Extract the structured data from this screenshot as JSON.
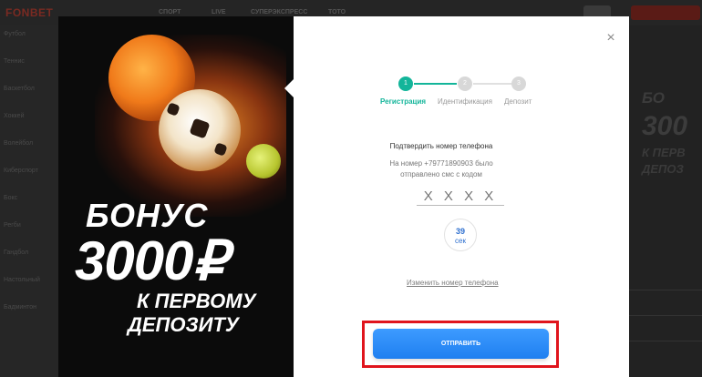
{
  "background": {
    "logo": "FONBET",
    "menu": [
      "СПОРТ",
      "LIVE",
      "СУПЕРЭКСПРЕСС",
      "ТОТО"
    ],
    "sidebar_items": [
      "Футбол",
      "Теннис",
      "Баскетбол",
      "Хоккей",
      "Волейбол",
      "Киберспорт",
      "Бокс",
      "Регби",
      "Гандбол",
      "Настольный",
      "Бадминтон"
    ],
    "right_promo_line1": "БО",
    "right_promo_line2": "300",
    "right_promo_line3": "К ПЕРВ",
    "right_promo_line4": "ДЕПОЗ"
  },
  "promo": {
    "line1": "БОНУС",
    "line2": "3000₽",
    "line3": "К ПЕРВОМУ",
    "line4": "ДЕПОЗИТУ"
  },
  "modal": {
    "close_icon": "×",
    "steps": [
      {
        "number": "1",
        "label": "Регистрация",
        "active": true
      },
      {
        "number": "2",
        "label": "Идентификация",
        "active": false
      },
      {
        "number": "3",
        "label": "Депозит",
        "active": false
      }
    ],
    "confirm_title": "Подтвердить номер телефона",
    "confirm_desc_line1": "На номер +79771890903 было",
    "confirm_desc_line2": "отправлено смс с кодом",
    "code_placeholder": "X X X X",
    "timer_value": "39",
    "timer_unit": "сек",
    "change_phone_label": "Изменить номер телефона",
    "submit_label": "ОТПРАВИТЬ"
  },
  "colors": {
    "accent_green": "#13b59a",
    "button_blue": "#1f7ff0",
    "highlight_red": "#e0141c"
  }
}
